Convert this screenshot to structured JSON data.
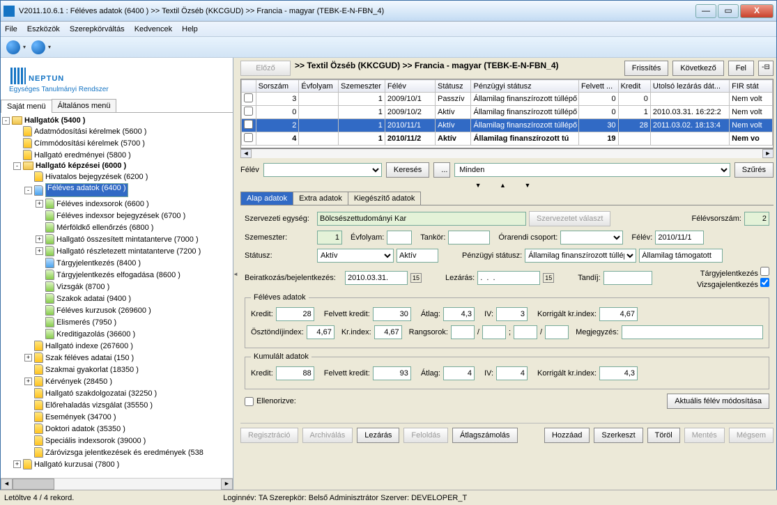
{
  "window": {
    "title": "V2011.10.6.1 : Féléves adatok (6400 )  >> Textil Özséb (KKCGUD) >> Francia - magyar  (TEBK-E-N-FBN_4)"
  },
  "menu": [
    "File",
    "Eszközök",
    "Szerepkörváltás",
    "Kedvencek",
    "Help"
  ],
  "logo": {
    "name": "NEPTUN",
    "sub": "Egységes Tanulmányi Rendszer"
  },
  "ltabs": {
    "own": "Saját menü",
    "gen": "Általános menü"
  },
  "tree": [
    {
      "d": 0,
      "t": "-",
      "i": "fld",
      "b": 1,
      "l": "Hallgatók (5400 )"
    },
    {
      "d": 1,
      "t": "",
      "i": "y",
      "l": "Adatmódosítási kérelmek (5600 )"
    },
    {
      "d": 1,
      "t": "",
      "i": "y",
      "l": "Címmódosítási kérelmek (5700 )"
    },
    {
      "d": 1,
      "t": "",
      "i": "y",
      "l": "Hallgató eredményei (5800 )"
    },
    {
      "d": 1,
      "t": "-",
      "i": "fld",
      "b": 1,
      "l": "Hallgató képzései (6000 )"
    },
    {
      "d": 2,
      "t": "",
      "i": "y",
      "l": "Hivatalos bejegyzések (6200 )"
    },
    {
      "d": 2,
      "t": "-",
      "i": "b",
      "sel": 1,
      "l": "Féléves adatok (6400 )"
    },
    {
      "d": 3,
      "t": "+",
      "i": "g",
      "l": "Féléves indexsorok (6600 )"
    },
    {
      "d": 3,
      "t": "",
      "i": "g",
      "l": "Féléves indexsor bejegyzések (6700 )"
    },
    {
      "d": 3,
      "t": "",
      "i": "g",
      "l": "Mérföldkő ellenőrzés (6800 )"
    },
    {
      "d": 3,
      "t": "+",
      "i": "g",
      "l": "Hallgató összesített mintatanterve (7000 )"
    },
    {
      "d": 3,
      "t": "+",
      "i": "g",
      "l": "Hallgató részletezett mintatanterve (7200 )"
    },
    {
      "d": 3,
      "t": "",
      "i": "b",
      "l": "Tárgyjelentkezés (8400 )"
    },
    {
      "d": 3,
      "t": "",
      "i": "g",
      "l": "Tárgyjelentkezés elfogadása (8600 )"
    },
    {
      "d": 3,
      "t": "",
      "i": "g",
      "l": "Vizsgák (8700 )"
    },
    {
      "d": 3,
      "t": "",
      "i": "g",
      "l": "Szakok adatai (9400 )"
    },
    {
      "d": 3,
      "t": "",
      "i": "g",
      "l": "Féléves kurzusok (269600 )"
    },
    {
      "d": 3,
      "t": "",
      "i": "g",
      "l": "Elismerés (7950 )"
    },
    {
      "d": 3,
      "t": "",
      "i": "g",
      "l": "Kreditigazolás (36600 )"
    },
    {
      "d": 2,
      "t": "",
      "i": "y",
      "l": "Hallgató indexe (267600 )"
    },
    {
      "d": 2,
      "t": "+",
      "i": "y",
      "l": "Szak féléves adatai (150 )"
    },
    {
      "d": 2,
      "t": "",
      "i": "y",
      "l": "Szakmai gyakorlat (18350 )"
    },
    {
      "d": 2,
      "t": "+",
      "i": "y",
      "l": "Kérvények (28450 )"
    },
    {
      "d": 2,
      "t": "",
      "i": "y",
      "l": "Hallgató szakdolgozatai (32250 )"
    },
    {
      "d": 2,
      "t": "",
      "i": "y",
      "l": "Előrehaladás vizsgálat (35550 )"
    },
    {
      "d": 2,
      "t": "",
      "i": "y",
      "l": "Események (34700 )"
    },
    {
      "d": 2,
      "t": "",
      "i": "y",
      "l": "Doktori adatok (35350 )"
    },
    {
      "d": 2,
      "t": "",
      "i": "y",
      "l": "Speciális indexsorok (39000 )"
    },
    {
      "d": 2,
      "t": "",
      "i": "y",
      "l": "Záróvizsga jelentkezések és eredmények (538"
    },
    {
      "d": 1,
      "t": "+",
      "i": "y",
      "l": "Hallgató kurzusai (7800 )"
    }
  ],
  "hdr": {
    "prev": "Előző",
    "bc": ">> Textil Özséb (KKCGUD) >> Francia - magyar (TEBK-E-N-FBN_4)",
    "refresh": "Frissítés",
    "next": "Következő",
    "up": "Fel"
  },
  "cols": [
    "Sorszám",
    "Évfolyam",
    "Szemeszter",
    "Félév",
    "Státusz",
    "Pénzügyi státusz",
    "Felvett ...",
    "Kredit",
    "Utolsó lezárás dát...",
    "FIR stát"
  ],
  "rows": [
    {
      "s": "3",
      "e": "",
      "sz": "1",
      "f": "2009/10/1",
      "st": "Passzív",
      "p": "Államilag finanszírozott túllépő (",
      "fk": "0",
      "k": "0",
      "u": "",
      "fi": "Nem volt",
      "sel": 0,
      "b": 0
    },
    {
      "s": "0",
      "e": "",
      "sz": "1",
      "f": "2009/10/2",
      "st": "Aktív",
      "p": "Államilag finanszírozott túllépő (",
      "fk": "0",
      "k": "1",
      "u": "2010.03.31. 16:22:2",
      "fi": "Nem volt",
      "sel": 0,
      "b": 0
    },
    {
      "s": "2",
      "e": "",
      "sz": "1",
      "f": "2010/11/1",
      "st": "Aktív",
      "p": "Államilag finanszírozott túllépő (",
      "fk": "30",
      "k": "28",
      "u": "2011.03.02. 18:13:4",
      "fi": "Nem volt",
      "sel": 1,
      "b": 0
    },
    {
      "s": "4",
      "e": "",
      "sz": "1",
      "f": "2010/11/2",
      "st": "Aktív",
      "p": "Államilag finanszírozott tú",
      "fk": "19",
      "k": "",
      "u": "",
      "fi": "Nem vo",
      "sel": 0,
      "b": 1
    }
  ],
  "filter": {
    "lbl": "Félév",
    "search": "Keresés",
    "all": "Minden",
    "flt": "Szűrés",
    "dots": "..."
  },
  "ftabs": {
    "a": "Alap adatok",
    "b": "Extra adatok",
    "c": "Kiegészítő adatok"
  },
  "form": {
    "org_l": "Szervezeti egység:",
    "org_v": "Bölcsészettudományi Kar",
    "org_btn": "Szervezetet választ",
    "fss_l": "Félévsorszám:",
    "fss_v": "2",
    "sem_l": "Szemeszter:",
    "sem_v": "1",
    "evf_l": "Évfolyam:",
    "evf_v": "",
    "tan_l": "Tankör:",
    "tan_v": "",
    "ocs_l": "Órarendi csoport:",
    "ocs_v": "",
    "fel_l": "Félév:",
    "fel_v": "2010/11/1",
    "st_l": "Státusz:",
    "st_v": "Aktív",
    "st2_v": "Aktív",
    "pst_l": "Pénzügyi státusz:",
    "pst_v": "Államilag finanszírozott túllépő (",
    "pst2_v": "Államilag támogatott",
    "bei_l": "Beiratkozás/bejelentkezés:",
    "bei_v": "2010.03.31.",
    "lez_l": "Lezárás:",
    "lez_v": ".  .  .",
    "tdj_l": "Tandíj:",
    "tdj_v": "",
    "tgy_l": "Tárgyjelentkezés",
    "vzs_l": "Vizsgajelentkezés",
    "grp_fa": "Féléves adatok",
    "kr_l": "Kredit:",
    "kr_v": "28",
    "fkr_l": "Felvett kredit:",
    "fkr_v": "30",
    "atl_l": "Átlag:",
    "atl_v": "4,3",
    "iv_l": "IV:",
    "iv_v": "3",
    "kki_l": "Korrigált kr.index:",
    "kki_v": "4,67",
    "odi_l": "Ösztöndíjindex:",
    "odi_v": "4,67",
    "kri_l": "Kr.index:",
    "kri_v": "4,67",
    "rng_l": "Rangsorok:",
    "meg_l": "Megjegyzés:",
    "grp_ka": "Kumulált adatok",
    "kkr_v": "88",
    "kfkr_v": "93",
    "katl_v": "4",
    "kiv_v": "4",
    "kkki_v": "4,3",
    "ell_l": "Ellenorizve:",
    "akt_btn": "Aktuális félév módosítása"
  },
  "btns": {
    "reg": "Regisztráció",
    "arch": "Archiválás",
    "lez": "Lezárás",
    "fold": "Feloldás",
    "atlsz": "Átlagszámolás",
    "add": "Hozzáad",
    "edit": "Szerkeszt",
    "del": "Töröl",
    "save": "Mentés",
    "canc": "Mégsem"
  },
  "status": {
    "rec": "Letöltve 4 / 4 rekord.",
    "login": "Loginnév: TA   Szerepkör: Belső Adminisztrátor   Szerver: DEVELOPER_T"
  }
}
